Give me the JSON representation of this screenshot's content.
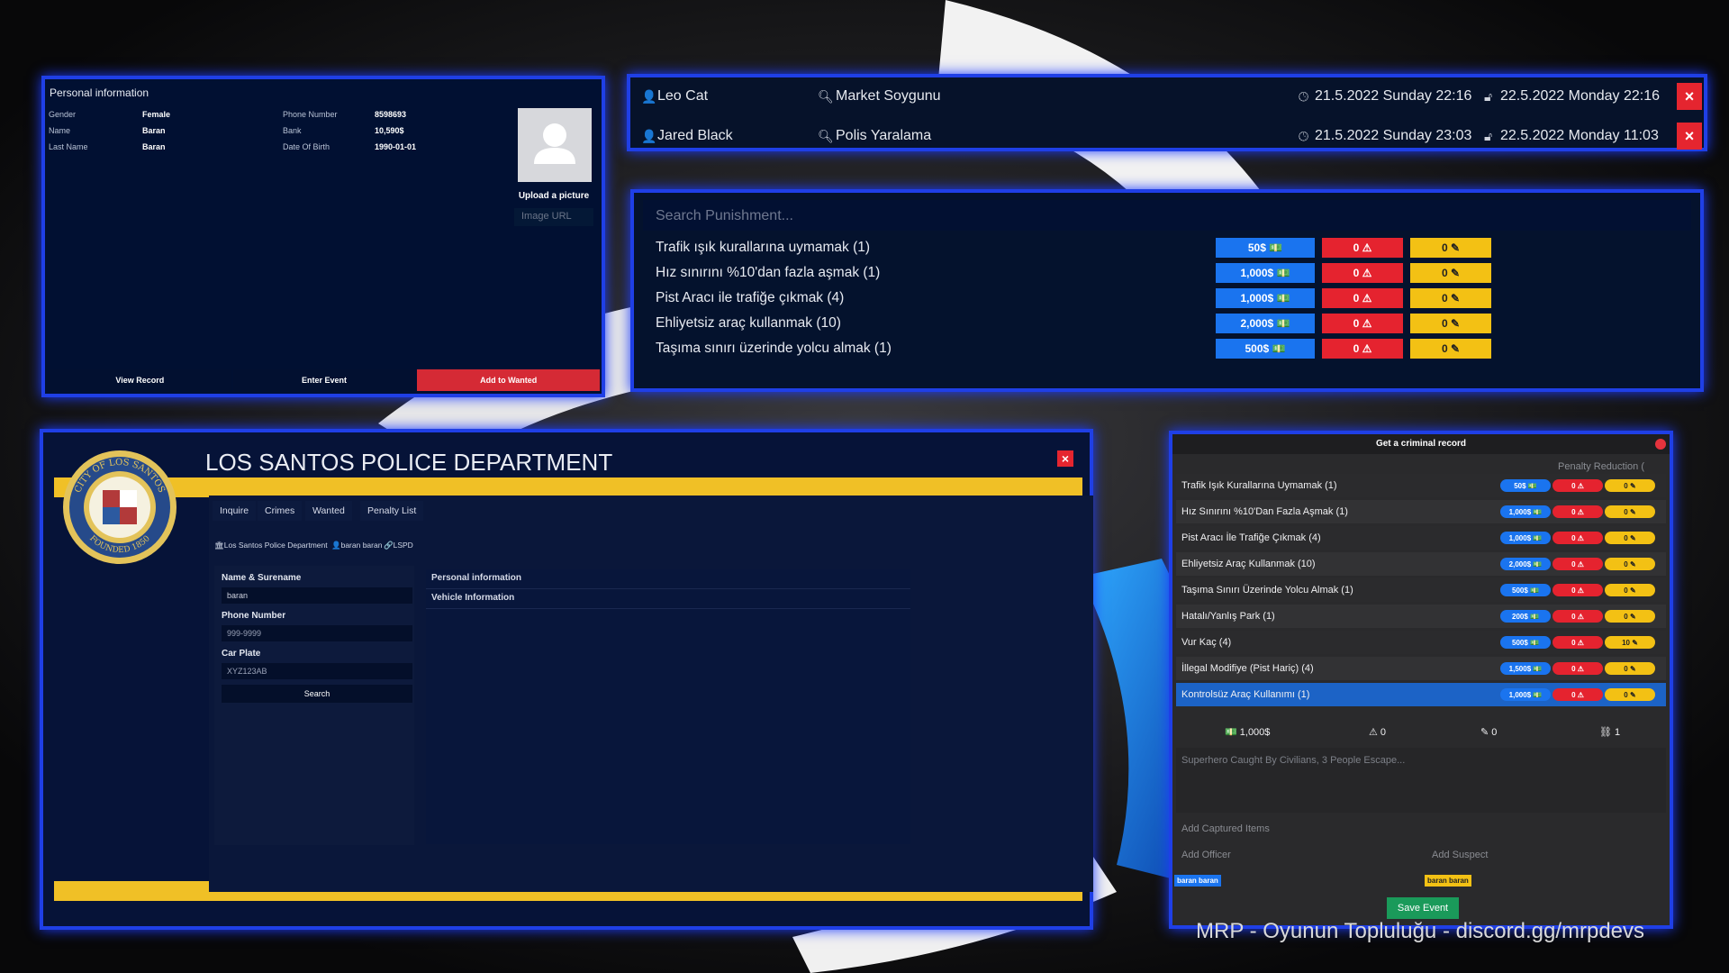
{
  "colors": {
    "accent_blue": "#1f3fe6",
    "red": "#e5252f",
    "yellow": "#f3c114",
    "chip_blue": "#1a74ef",
    "green": "#1a9a5a"
  },
  "personal": {
    "title": "Personal information",
    "left": [
      {
        "k": "Gender",
        "v": "Female"
      },
      {
        "k": "Name",
        "v": "Baran"
      },
      {
        "k": "Last Name",
        "v": "Baran"
      }
    ],
    "right": [
      {
        "k": "Phone Number",
        "v": "8598693"
      },
      {
        "k": "Bank",
        "v": "10,590$"
      },
      {
        "k": "Date Of Birth",
        "v": "1990-01-01"
      }
    ],
    "upload_label": "Upload a picture",
    "url_placeholder": "Image URL",
    "buttons": {
      "view": "View Record",
      "enter": "Enter Event",
      "wanted": "Add to Wanted"
    }
  },
  "records": [
    {
      "name": "Leo Cat",
      "crime": "Market Soygunu",
      "start": "21.5.2022 Sunday 22:16",
      "end": "22.5.2022 Monday 22:16",
      "close": "×"
    },
    {
      "name": "Jared Black",
      "crime": "Polis Yaralama",
      "start": "21.5.2022 Sunday 23:03",
      "end": "22.5.2022 Monday 11:03",
      "close": "×"
    }
  ],
  "punishment": {
    "placeholder": "Search Punishment...",
    "rows": [
      {
        "label": "Trafik ışık kurallarına uymamak (1)",
        "fine": "50$",
        "warn": "0",
        "jail": "0"
      },
      {
        "label": "Hız sınırını %10'dan fazla aşmak (1)",
        "fine": "1,000$",
        "warn": "0",
        "jail": "0"
      },
      {
        "label": "Pist Aracı ile trafiğe çıkmak (4)",
        "fine": "1,000$",
        "warn": "0",
        "jail": "0"
      },
      {
        "label": "Ehliyetsiz araç kullanmak (10)",
        "fine": "2,000$",
        "warn": "0",
        "jail": "0"
      },
      {
        "label": "Taşıma sınırı üzerinde yolcu almak (1)",
        "fine": "500$",
        "warn": "0",
        "jail": "0"
      }
    ]
  },
  "lspd": {
    "title": "LOS SANTOS POLICE DEPARTMENT",
    "close": "×",
    "seal": {
      "top": "CITY OF LOS SANTOS",
      "bottom": "FOUNDED 1850"
    },
    "tabs": [
      "Inquire",
      "Crimes",
      "Wanted",
      "Penalty List"
    ],
    "crumbs": [
      "Los Santos Police Department",
      "baran baran",
      "LSPD"
    ],
    "form": {
      "name_label": "Name & Surename",
      "name_value": "baran",
      "phone_label": "Phone Number",
      "phone_placeholder": "999-9999",
      "plate_label": "Car Plate",
      "plate_placeholder": "XYZ123AB",
      "search": "Search"
    },
    "info": [
      "Personal information",
      "Vehicle Information"
    ]
  },
  "criminal": {
    "title": "Get a criminal record",
    "penalty_reduction": "Penalty Reduction (",
    "rows": [
      {
        "label": "Trafik Işık Kurallarına Uymamak (1)",
        "fine": "50$",
        "warn": "0",
        "jail": "0"
      },
      {
        "label": "Hız Sınırını %10'Dan Fazla Aşmak (1)",
        "fine": "1,000$",
        "warn": "0",
        "jail": "0"
      },
      {
        "label": "Pist Aracı İle Trafiğe Çıkmak (4)",
        "fine": "1,000$",
        "warn": "0",
        "jail": "0"
      },
      {
        "label": "Ehliyetsiz Araç Kullanmak (10)",
        "fine": "2,000$",
        "warn": "0",
        "jail": "0"
      },
      {
        "label": "Taşıma Sınırı Üzerinde Yolcu Almak (1)",
        "fine": "500$",
        "warn": "0",
        "jail": "0"
      },
      {
        "label": "Hatalı/Yanlış Park (1)",
        "fine": "200$",
        "warn": "0",
        "jail": "0"
      },
      {
        "label": "Vur Kaç (4)",
        "fine": "500$",
        "warn": "0",
        "jail": "10"
      },
      {
        "label": "İllegal Modifiye (Pist Hariç) (4)",
        "fine": "1,500$",
        "warn": "0",
        "jail": "0"
      },
      {
        "label": "Kontrolsüz Araç Kullanımı (1)",
        "fine": "1,000$",
        "warn": "0",
        "jail": "0"
      }
    ],
    "summary": {
      "fine": "1,000$",
      "warn": "0",
      "jail": "0",
      "count": "1"
    },
    "description": "Superhero Caught By Civilians, 3 People Escape...",
    "captured_placeholder": "Add Captured Items",
    "officer_placeholder": "Add Officer",
    "suspect_placeholder": "Add Suspect",
    "officer_tag": "baran baran",
    "suspect_tag": "baran baran",
    "save": "Save Event"
  },
  "watermark": "MRP - Oyunun Topluluğu - discord.gg/mrpdevs"
}
